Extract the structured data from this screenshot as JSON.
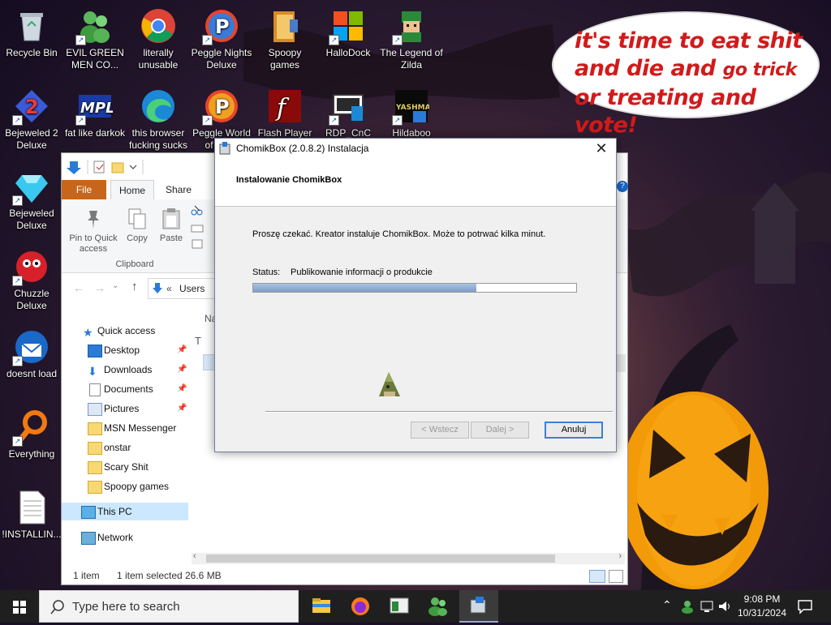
{
  "desktop": {
    "icons": [
      {
        "label": "Recycle Bin",
        "icon": "recycle-bin-icon"
      },
      {
        "label": "EVIL GREEN MEN CO...",
        "icon": "msn-people-icon"
      },
      {
        "label": "literally unusable",
        "icon": "chrome-icon"
      },
      {
        "label": "Peggle Nights Deluxe",
        "icon": "peggle-icon"
      },
      {
        "label": "Spoopy games",
        "icon": "folder-icon"
      },
      {
        "label": "HalloDock",
        "icon": "windows-logo-icon"
      },
      {
        "label": "The Legend of Zilda",
        "icon": "zelda-icon"
      },
      {
        "label": "Bejeweled 2 Deluxe",
        "icon": "bejeweled2-icon"
      },
      {
        "label": "fat like darkok",
        "icon": "mpl-icon"
      },
      {
        "label": "this browser fucking sucks",
        "icon": "edge-icon"
      },
      {
        "label": "Peggle World of Wa...",
        "icon": "peggle-icon"
      },
      {
        "label": "Flash Player",
        "icon": "flash-icon"
      },
      {
        "label": "RDP_CnC",
        "icon": "rdp-icon"
      },
      {
        "label": "Hildaboo",
        "icon": "yashma-icon"
      },
      {
        "label": "Bejeweled Deluxe",
        "icon": "diamond-icon"
      },
      {
        "label": "Chuzzle Deluxe",
        "icon": "chuzzle-icon"
      },
      {
        "label": "doesnt load",
        "icon": "thunderbird-icon"
      },
      {
        "label": "Everything",
        "icon": "search-magnifier-icon"
      },
      {
        "label": "!INSTALLIN...",
        "icon": "text-document-icon"
      }
    ],
    "bubble": {
      "line1": "it's time to eat shit",
      "line2a": "and die and ",
      "line2b": "go trick",
      "line3": "or treating and vote!"
    }
  },
  "explorer": {
    "tabs": {
      "file": "File",
      "home": "Home",
      "share": "Share"
    },
    "ribbon": {
      "pin_label": "Pin to Quick access",
      "copy_label": "Copy",
      "paste_label": "Paste",
      "group_clipboard": "Clipboard"
    },
    "address": {
      "crumb_sep": "«",
      "crumb": "Users"
    },
    "column_name": "Na",
    "nav": {
      "quick_access": "Quick access",
      "items": [
        {
          "label": "Desktop",
          "pinned": true
        },
        {
          "label": "Downloads",
          "pinned": true
        },
        {
          "label": "Documents",
          "pinned": true
        },
        {
          "label": "Pictures",
          "pinned": true
        },
        {
          "label": "MSN Messenger",
          "pinned": false
        },
        {
          "label": "onstar",
          "pinned": false
        },
        {
          "label": "Scary Shit",
          "pinned": false
        },
        {
          "label": "Spoopy games",
          "pinned": false
        }
      ],
      "this_pc": "This PC",
      "network": "Network"
    },
    "status": {
      "count": "1 item",
      "selected": "1 item selected",
      "size": "26.6 MB"
    }
  },
  "dialog": {
    "title": "ChomikBox (2.0.8.2) Instalacja",
    "heading": "Instalowanie ChomikBox",
    "message": "Proszę czekać. Kreator instaluje ChomikBox. Może to potrwać kilka minut.",
    "status_label": "Status:",
    "status_value": "Publikowanie informacji o produkcie",
    "progress_percent": 69,
    "buttons": {
      "back": "< Wstecz",
      "next": "Dalej >",
      "cancel": "Anuluj"
    }
  },
  "taskbar": {
    "search_placeholder": "Type here to search",
    "apps": [
      "file-explorer-icon",
      "firefox-icon",
      "window-app-icon",
      "msn-people-icon",
      "installer-icon"
    ],
    "clock": {
      "time": "9:08 PM",
      "date": "10/31/2024"
    }
  }
}
